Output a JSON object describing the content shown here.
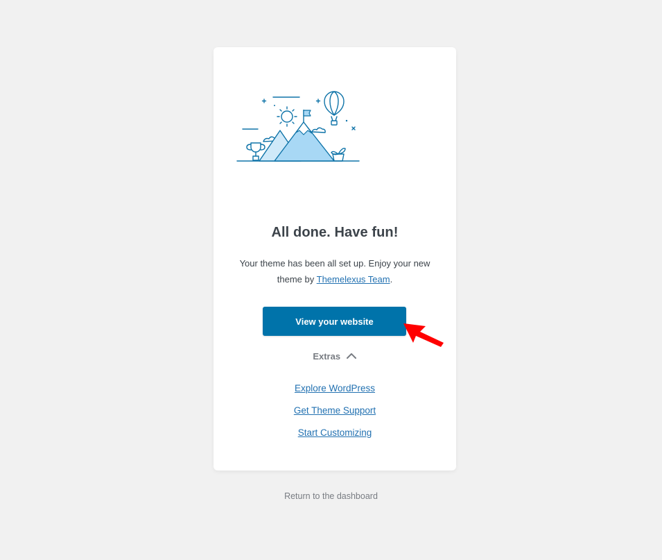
{
  "wizard": {
    "illustration_icon": "mountain-flag-balloon-illustration",
    "title": "All done. Have fun!",
    "description_prefix": "Your theme has been all set up. Enjoy your new theme by ",
    "author_link": "Themelexus Team",
    "description_suffix": ".",
    "primary_button": "View your website",
    "extras_label": "Extras",
    "extras_icon": "chevron-up-icon",
    "links": [
      {
        "label": "Explore WordPress"
      },
      {
        "label": "Get Theme Support"
      },
      {
        "label": "Start Customizing"
      }
    ]
  },
  "footer": {
    "return_link": "Return to the dashboard"
  },
  "annotation": {
    "icon": "red-pointer-arrow",
    "color": "#ff0000"
  },
  "colors": {
    "background": "#f1f1f1",
    "card": "#ffffff",
    "primary": "#0073aa",
    "link": "#2271b1",
    "illustration_stroke": "#0e73a8",
    "illustration_fill": "#a8d8f5"
  }
}
